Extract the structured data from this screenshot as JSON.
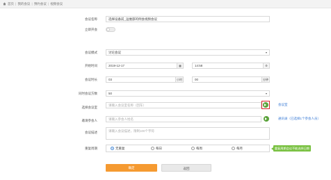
{
  "breadcrumb": [
    "首页",
    "我的会议",
    "预约会议",
    "视频会议"
  ],
  "form": {
    "subject": {
      "label": "会议名称",
      "value": "选择设备前_运维部的例会视频会议"
    },
    "instant": {
      "label": "立即开会"
    },
    "mode": {
      "label": "会议模式",
      "value": "讨论会议"
    },
    "start": {
      "label": "开始时间",
      "date": "2019-12-17",
      "time": "14:58"
    },
    "duration": {
      "label": "会议时长",
      "hours": "03",
      "hours_unit": "小时",
      "minutes": "00",
      "minutes_unit": "分钟"
    },
    "capacity": {
      "label": "同时会议方数",
      "value": "50"
    },
    "room": {
      "label": "选择会议室",
      "placeholder": "请输入会议室名称（回车）",
      "side": "会议室"
    },
    "participants": {
      "label": "邀请参会人",
      "placeholder": "请输入参会人姓名",
      "side": "通讯录（已选择1个参会人员）"
    },
    "desc": {
      "label": "会议描述",
      "placeholder": "请输入会议描述，限制100个字符"
    },
    "repeat": {
      "label": "重复周期",
      "options": [
        "无重复",
        "每日",
        "每周",
        "每月"
      ],
      "selected": 0,
      "tag": "重复周期会议不能选择日期"
    }
  },
  "buttons": {
    "confirm": "确定",
    "back": "返回"
  }
}
